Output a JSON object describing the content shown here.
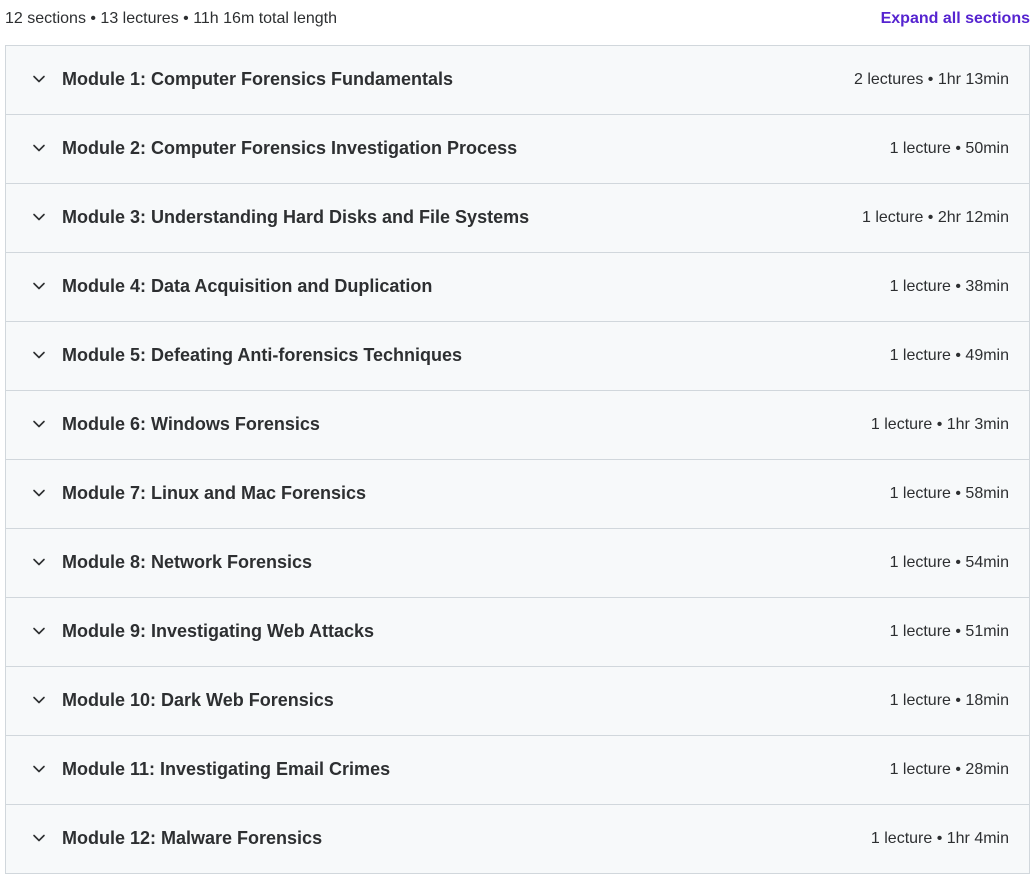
{
  "curriculum": {
    "summary": "12 sections • 13 lectures • 11h 16m total length",
    "expand_all_label": "Expand all sections",
    "sections": [
      {
        "title": "Module 1: Computer Forensics Fundamentals",
        "meta": "2 lectures • 1hr 13min"
      },
      {
        "title": "Module 2: Computer Forensics Investigation Process",
        "meta": "1 lecture • 50min"
      },
      {
        "title": "Module 3: Understanding Hard Disks and File Systems",
        "meta": "1 lecture • 2hr 12min"
      },
      {
        "title": "Module 4: Data Acquisition and Duplication",
        "meta": "1 lecture • 38min"
      },
      {
        "title": "Module 5: Defeating Anti-forensics Techniques",
        "meta": "1 lecture • 49min"
      },
      {
        "title": "Module 6: Windows Forensics",
        "meta": "1 lecture • 1hr 3min"
      },
      {
        "title": "Module 7: Linux and Mac Forensics",
        "meta": "1 lecture • 58min"
      },
      {
        "title": "Module 8: Network Forensics",
        "meta": "1 lecture • 54min"
      },
      {
        "title": "Module 9: Investigating Web Attacks",
        "meta": "1 lecture • 51min"
      },
      {
        "title": "Module 10: Dark Web Forensics",
        "meta": "1 lecture • 18min"
      },
      {
        "title": "Module 11: Investigating Email Crimes",
        "meta": "1 lecture • 28min"
      },
      {
        "title": "Module 12: Malware Forensics",
        "meta": "1 lecture • 1hr 4min"
      }
    ]
  },
  "icons": {
    "section_toggle": "chevron-down-icon"
  },
  "colors": {
    "accent": "#5624d0",
    "text": "#2d2f31",
    "section_bg": "#f7f9fa",
    "border": "#d1d7dc"
  }
}
